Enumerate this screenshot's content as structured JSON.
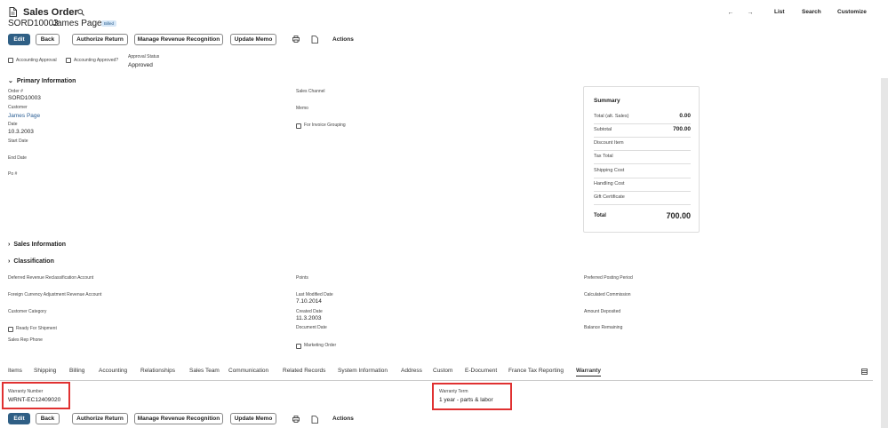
{
  "header": {
    "record_type": "Sales Order",
    "record_number": "SORD10003",
    "customer_name": "James Page",
    "status_badge": "Billed",
    "nav": {
      "list": "List",
      "search": "Search",
      "customize": "Customize"
    }
  },
  "toolbar": {
    "edit": "Edit",
    "back": "Back",
    "authorize_return": "Authorize Return",
    "manage_revenue_recognition": "Manage Revenue Recognition",
    "update_memo": "Update Memo",
    "actions": "Actions"
  },
  "approval": {
    "accounting_approval": "Accounting Approval",
    "accounting_approved": "Accounting Approved?",
    "approval_status_label": "Approval Status",
    "approval_status_value": "Approved"
  },
  "primary": {
    "section_title": "Primary Information",
    "order_label": "Order #",
    "order_value": "SORD10003",
    "customer_label": "Customer",
    "customer_value": "James Page",
    "date_label": "Date",
    "date_value": "10.3.2003",
    "start_date_label": "Start Date",
    "end_date_label": "End Date",
    "po_label": "Po #",
    "sales_channel_label": "Sales Channel",
    "memo_label": "Memo",
    "invoice_grouping_label": "For Invoice Grouping"
  },
  "summary": {
    "title": "Summary",
    "rows": [
      {
        "label": "Total (alt. Sales)",
        "value": "0.00"
      },
      {
        "label": "Subtotal",
        "value": "700.00"
      },
      {
        "label": "Discount Item",
        "value": ""
      },
      {
        "label": "Tax Total",
        "value": ""
      },
      {
        "label": "Shipping Cost",
        "value": ""
      },
      {
        "label": "Handling Cost",
        "value": ""
      },
      {
        "label": "Gift Certificate",
        "value": ""
      }
    ],
    "total_label": "Total",
    "total_value": "700.00"
  },
  "sections": {
    "sales_information": "Sales Information",
    "classification": "Classification"
  },
  "classification": {
    "deferred_revenue": "Deferred Revenue Reclassification Account",
    "foreign_currency": "Foreign Currency Adjustment Revenue Account",
    "customer_category": "Customer Category",
    "ready_for_shipment": "Ready For Shipment",
    "sales_rep_phone": "Sales Rep Phone",
    "points": "Points",
    "last_modified_label": "Last Modified Date",
    "last_modified_value": "7.10.2014",
    "created_label": "Created Date",
    "created_value": "11.3.2003",
    "document_date": "Document Date",
    "marketing_order": "Marketing Order",
    "preferred_posting_period": "Preferred Posting Period",
    "calculated_commission": "Calculated Commission",
    "amount_deposited": "Amount Deposited",
    "balance_remaining": "Balance Remaining"
  },
  "tabs": [
    "Items",
    "Shipping",
    "Billing",
    "Accounting",
    "Relationships",
    "Sales Team",
    "Communication",
    "Related Records",
    "System Information",
    "Address",
    "Custom",
    "E-Document",
    "France Tax Reporting",
    "Warranty"
  ],
  "warranty": {
    "number_label": "Warranty Number",
    "number_value": "WRNT-EC12409020",
    "term_label": "Warranty Term",
    "term_value": "1 year - parts & labor"
  },
  "colors": {
    "primary_button": "#2f5f85",
    "highlight": "#e03131",
    "link": "#2a5e94"
  }
}
